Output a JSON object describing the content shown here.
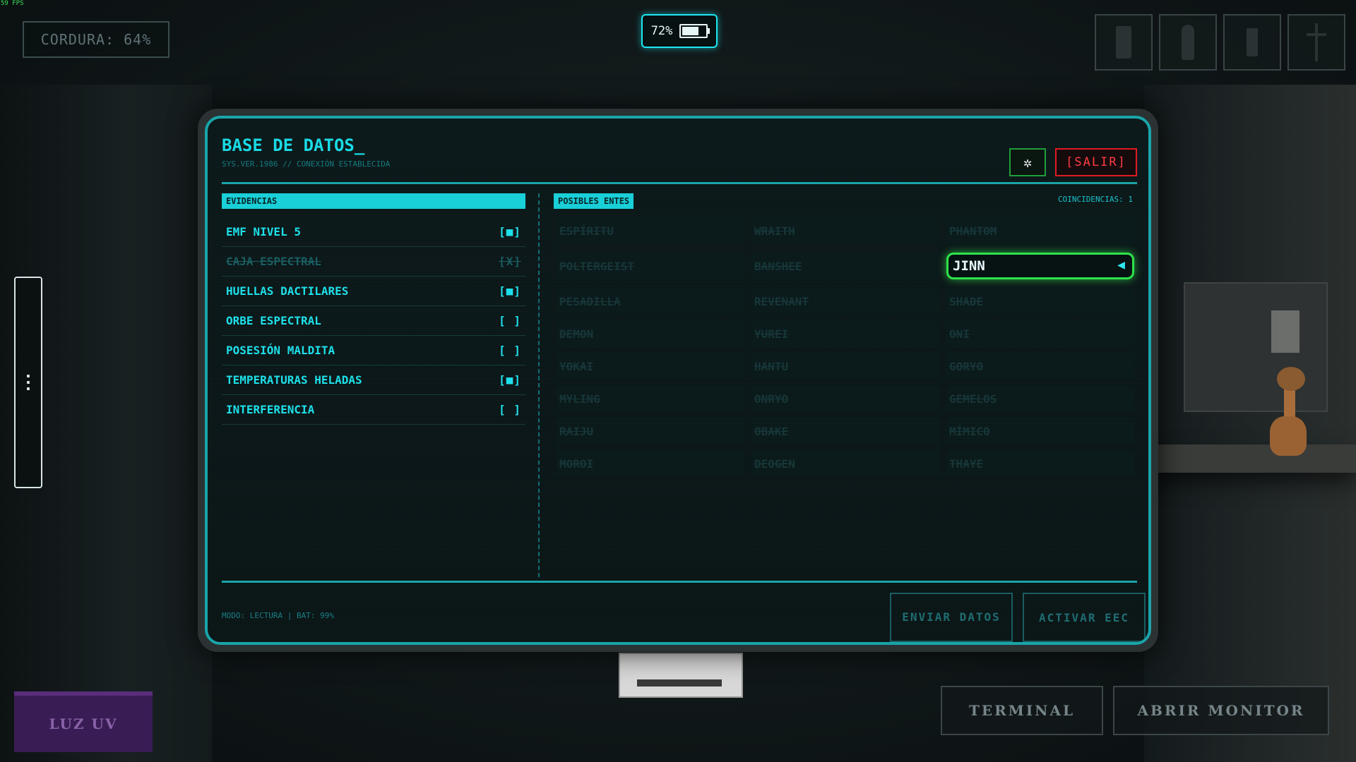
{
  "hud": {
    "fps": "59 FPS",
    "sanity": "CORDURA: 64%",
    "battery_percent": "72%",
    "battery_level": 0.64
  },
  "inventory": [
    {
      "icon": "walkie-talkie-icon"
    },
    {
      "icon": "flashlight-icon"
    },
    {
      "icon": "radio-icon"
    },
    {
      "icon": "crucifix-icon"
    }
  ],
  "side_tab": {
    "icon_glyph": "⋮"
  },
  "database": {
    "title": "BASE DE DATOS_",
    "subtitle": "SYS.VER.1986 // CONEXIÓN ESTABLECIDA",
    "settings_glyph": "✲",
    "exit_label": "[SALIR]",
    "evidence_header": "EVIDENCIAS",
    "evidence": [
      {
        "label": "EMF NIVEL 5",
        "mark": "[■]",
        "state": "confirmed"
      },
      {
        "label": "CAJA ESPECTRAL",
        "mark": "[X]",
        "state": "excluded"
      },
      {
        "label": "HUELLAS DACTILARES",
        "mark": "[■]",
        "state": "confirmed"
      },
      {
        "label": "ORBE ESPECTRAL",
        "mark": "[ ]",
        "state": "unknown"
      },
      {
        "label": "POSESIÓN MALDITA",
        "mark": "[ ]",
        "state": "unknown"
      },
      {
        "label": "TEMPERATURAS HELADAS",
        "mark": "[■]",
        "state": "confirmed"
      },
      {
        "label": "INTERFERENCIA",
        "mark": "[ ]",
        "state": "unknown"
      }
    ],
    "entities_header": "POSIBLES ENTES",
    "matches": "COINCIDENCIAS: 1",
    "entities": [
      {
        "name": "ESPÍRITU",
        "active": false
      },
      {
        "name": "WRAITH",
        "active": false
      },
      {
        "name": "PHANTOM",
        "active": false
      },
      {
        "name": "POLTERGEIST",
        "active": false
      },
      {
        "name": "BANSHEE",
        "active": false
      },
      {
        "name": "JINN",
        "active": true
      },
      {
        "name": "PESADILLA",
        "active": false
      },
      {
        "name": "REVENANT",
        "active": false
      },
      {
        "name": "SHADE",
        "active": false
      },
      {
        "name": "DEMON",
        "active": false
      },
      {
        "name": "YUREI",
        "active": false
      },
      {
        "name": "ONI",
        "active": false
      },
      {
        "name": "YOKAI",
        "active": false
      },
      {
        "name": "HANTU",
        "active": false
      },
      {
        "name": "GORYO",
        "active": false
      },
      {
        "name": "MYLING",
        "active": false
      },
      {
        "name": "ONRYO",
        "active": false
      },
      {
        "name": "GEMELOS",
        "active": false
      },
      {
        "name": "RAIJU",
        "active": false
      },
      {
        "name": "OBAKE",
        "active": false
      },
      {
        "name": "MÍMICO",
        "active": false
      },
      {
        "name": "MOROI",
        "active": false
      },
      {
        "name": "DEOGEN",
        "active": false
      },
      {
        "name": "THAYE",
        "active": false
      }
    ],
    "active_arrow": "◀",
    "mode_status": "MODO: LECTURA | BAT: 99%",
    "send_label": "ENVIAR DATOS",
    "eec_label": "ACTIVAR EEC"
  },
  "bottom": {
    "uv_label": "LUZ UV",
    "terminal_label": "TERMINAL",
    "monitor_label": "ABRIR MONITOR"
  },
  "colors": {
    "accent": "#19dbe6",
    "active_entity_border": "#2fe24a",
    "exit": "#e01b24",
    "uv": "#3a1c54"
  }
}
